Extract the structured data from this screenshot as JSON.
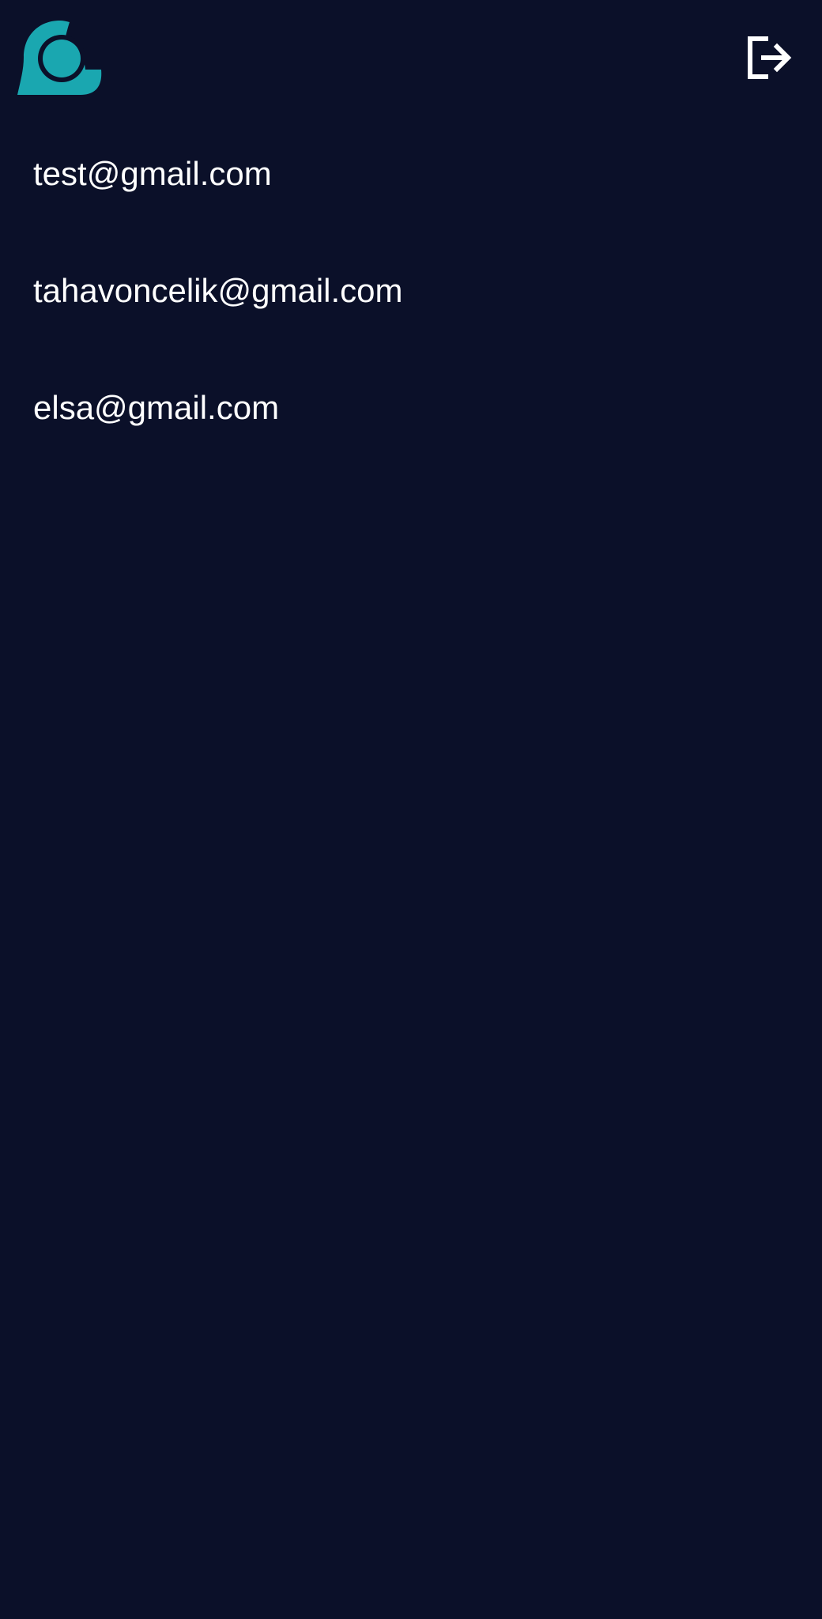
{
  "app": {
    "logo_icon": "chat-bubble-logo-icon",
    "logout_icon": "logout-icon",
    "colors": {
      "background": "#0b1029",
      "brand": "#1aa7b0",
      "text": "#ffffff"
    }
  },
  "users": [
    {
      "email": "test@gmail.com"
    },
    {
      "email": "tahavoncelik@gmail.com"
    },
    {
      "email": "elsa@gmail.com"
    }
  ]
}
